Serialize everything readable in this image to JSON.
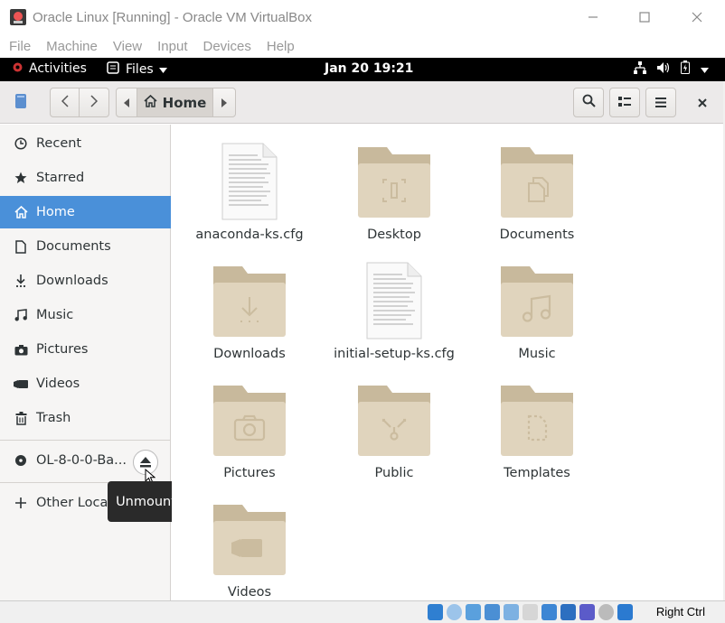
{
  "window": {
    "title": "Oracle Linux [Running] - Oracle VM VirtualBox",
    "menus": [
      "File",
      "Machine",
      "View",
      "Input",
      "Devices",
      "Help"
    ]
  },
  "gnome": {
    "activities": "Activities",
    "app_menu": "Files",
    "clock": "Jan 20  19:21"
  },
  "header": {
    "path_current": "Home"
  },
  "sidebar": {
    "items": [
      {
        "label": "Recent",
        "icon": "clock-icon"
      },
      {
        "label": "Starred",
        "icon": "star-icon"
      },
      {
        "label": "Home",
        "icon": "home-icon"
      },
      {
        "label": "Documents",
        "icon": "document-icon"
      },
      {
        "label": "Downloads",
        "icon": "download-icon"
      },
      {
        "label": "Music",
        "icon": "music-icon"
      },
      {
        "label": "Pictures",
        "icon": "camera-icon"
      },
      {
        "label": "Videos",
        "icon": "video-icon"
      },
      {
        "label": "Trash",
        "icon": "trash-icon"
      }
    ],
    "device": "OL-8-0-0-Ba...",
    "other_locations": "Other Locations",
    "tooltip": "Unmount"
  },
  "files": [
    {
      "name": "anaconda-ks.cfg",
      "kind": "text-file"
    },
    {
      "name": "Desktop",
      "kind": "folder"
    },
    {
      "name": "Documents",
      "kind": "folder"
    },
    {
      "name": "Downloads",
      "kind": "folder"
    },
    {
      "name": "initial-setup-ks.cfg",
      "kind": "text-file"
    },
    {
      "name": "Music",
      "kind": "folder"
    },
    {
      "name": "Pictures",
      "kind": "folder"
    },
    {
      "name": "Public",
      "kind": "folder"
    },
    {
      "name": "Templates",
      "kind": "folder"
    },
    {
      "name": "Videos",
      "kind": "folder"
    }
  ],
  "statusbar": {
    "host_key": "Right Ctrl"
  },
  "colors": {
    "accent": "#4a90d9",
    "folder": "#e0d4bd",
    "folder_tab": "#c8b99c"
  }
}
